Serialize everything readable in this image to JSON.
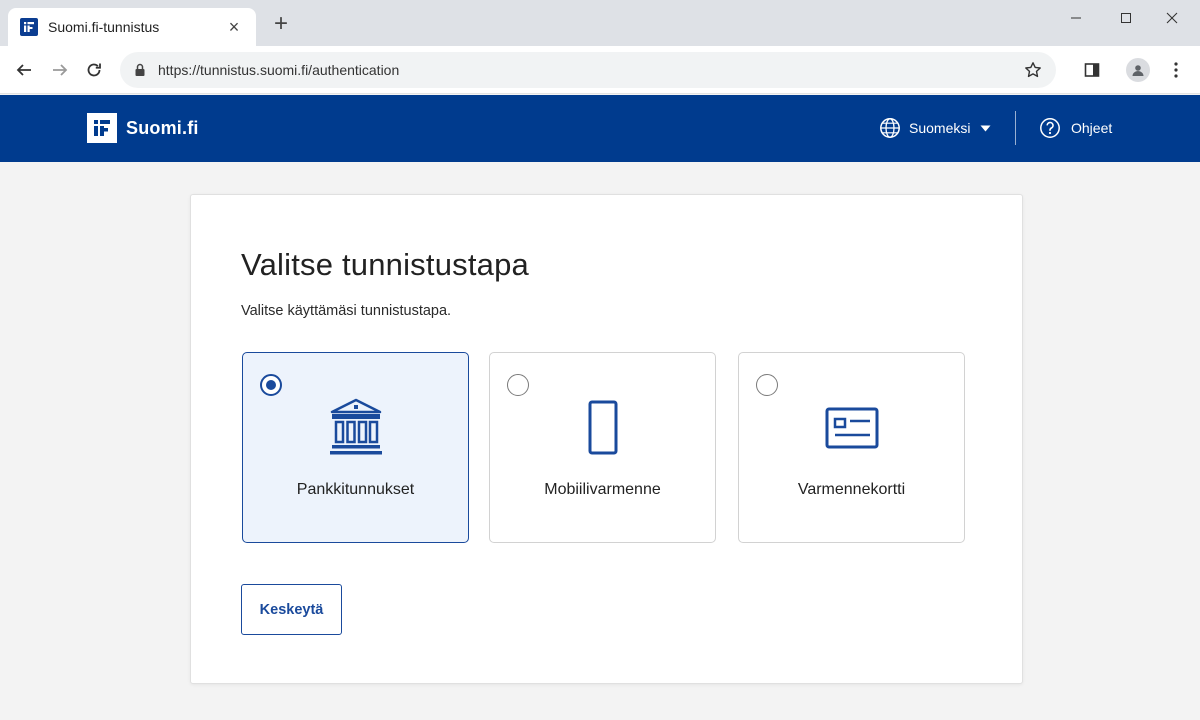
{
  "browser": {
    "tab_title": "Suomi.fi-tunnistus",
    "url": "https://tunnistus.suomi.fi/authentication"
  },
  "header": {
    "brand": "Suomi.fi",
    "language": "Suomeksi",
    "help": "Ohjeet",
    "background_color": "#003b8e"
  },
  "main": {
    "title": "Valitse tunnistustapa",
    "subtitle": "Valitse käyttämäsi tunnistustapa.",
    "options": [
      {
        "label": "Pankkitunnukset",
        "icon": "bank-icon",
        "selected": true
      },
      {
        "label": "Mobiilivarmenne",
        "icon": "mobile-phone-icon",
        "selected": false
      },
      {
        "label": "Varmennekortti",
        "icon": "id-card-icon",
        "selected": false
      }
    ],
    "cancel_label": "Keskeytä",
    "accent_color": "#1a4a9c"
  }
}
